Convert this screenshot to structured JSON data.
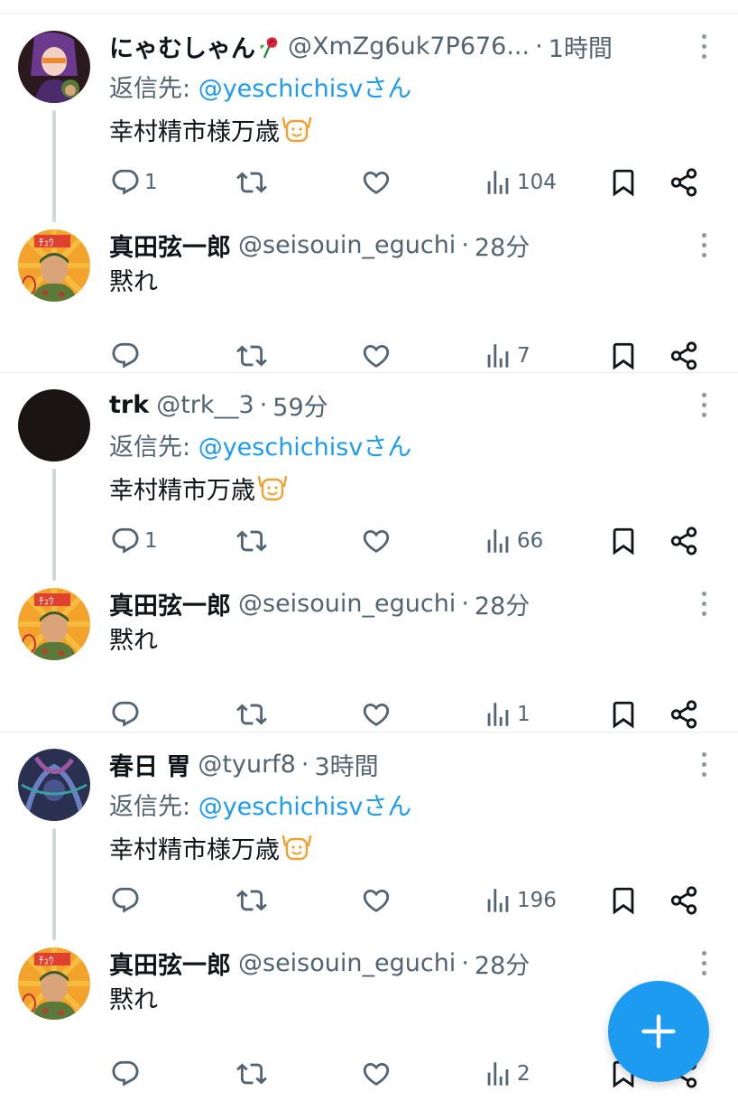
{
  "replying_label": "返信先: ",
  "threads": [
    {
      "tweet": {
        "name": "にゃむしゃん",
        "handle": "@XmZg6uk7P676...",
        "time": "1時間",
        "reply_mention": "@yeschichisv",
        "reply_suffix": "さん",
        "text": "幸村精市様万歳",
        "counts": {
          "replies": "1",
          "views": "104"
        }
      },
      "reply": {
        "name": "真田弦一郎",
        "handle": "@seisouin_eguchi",
        "time": "28分",
        "text": "黙れ",
        "counts": {
          "replies": "",
          "views": "7"
        }
      }
    },
    {
      "tweet": {
        "name": "trk",
        "handle": "@trk__3",
        "time": "59分",
        "reply_mention": "@yeschichisv",
        "reply_suffix": "さん",
        "text": "幸村精市万歳",
        "counts": {
          "replies": "1",
          "views": "66"
        }
      },
      "reply": {
        "name": "真田弦一郎",
        "handle": "@seisouin_eguchi",
        "time": "28分",
        "text": "黙れ",
        "counts": {
          "replies": "",
          "views": "1"
        }
      }
    },
    {
      "tweet": {
        "name": "春日 胃",
        "handle": "@tyurf8",
        "time": "3時間",
        "reply_mention": "@yeschichisv",
        "reply_suffix": "さん",
        "text": "幸村精市様万歳",
        "counts": {
          "replies": "",
          "views": "196"
        }
      },
      "reply": {
        "name": "真田弦一郎",
        "handle": "@seisouin_eguchi",
        "time": "28分",
        "text": "黙れ",
        "counts": {
          "replies": "",
          "views": "2"
        }
      }
    }
  ],
  "icons": {
    "reply": "reply-icon",
    "retweet": "retweet-icon",
    "like": "heart-icon",
    "views": "views-icon",
    "bookmark": "bookmark-icon",
    "share": "share-icon",
    "more": "more-icon",
    "compose": "plus-icon"
  },
  "colors": {
    "accent": "#1d9bf0",
    "muted": "#536471",
    "text": "#0f1419",
    "thread_line": "#cfd9de"
  }
}
